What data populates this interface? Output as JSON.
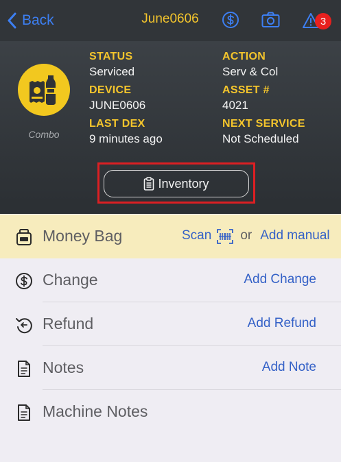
{
  "nav": {
    "back_label": "Back",
    "title": "June0606",
    "alert_count": "3"
  },
  "header": {
    "avatar_caption": "Combo",
    "fields": {
      "status_label": "STATUS",
      "status_value": "Serviced",
      "action_label": "ACTION",
      "action_value": "Serv & Col",
      "device_label": "DEVICE",
      "device_value": "JUNE0606",
      "asset_label": "ASSET #",
      "asset_value": "4021",
      "lastdex_label": "LAST DEX",
      "lastdex_value": "9 minutes ago",
      "nextservice_label": "NEXT SERVICE",
      "nextservice_value": "Not Scheduled"
    },
    "inventory_label": "Inventory"
  },
  "list": {
    "money_bag": {
      "label": "Money Bag",
      "scan": "Scan",
      "or": "or",
      "action": "Add manual"
    },
    "change": {
      "label": "Change",
      "action": "Add Change"
    },
    "refund": {
      "label": "Refund",
      "action": "Add Refund"
    },
    "notes": {
      "label": "Notes",
      "action": "Add Note"
    },
    "machine_notes": {
      "label": "Machine Notes"
    }
  },
  "colors": {
    "accent": "#f4c52c",
    "link": "#3461c7",
    "header_bg": "#313539",
    "highlight_row": "#f7ecbd",
    "badge": "#e8201e"
  }
}
